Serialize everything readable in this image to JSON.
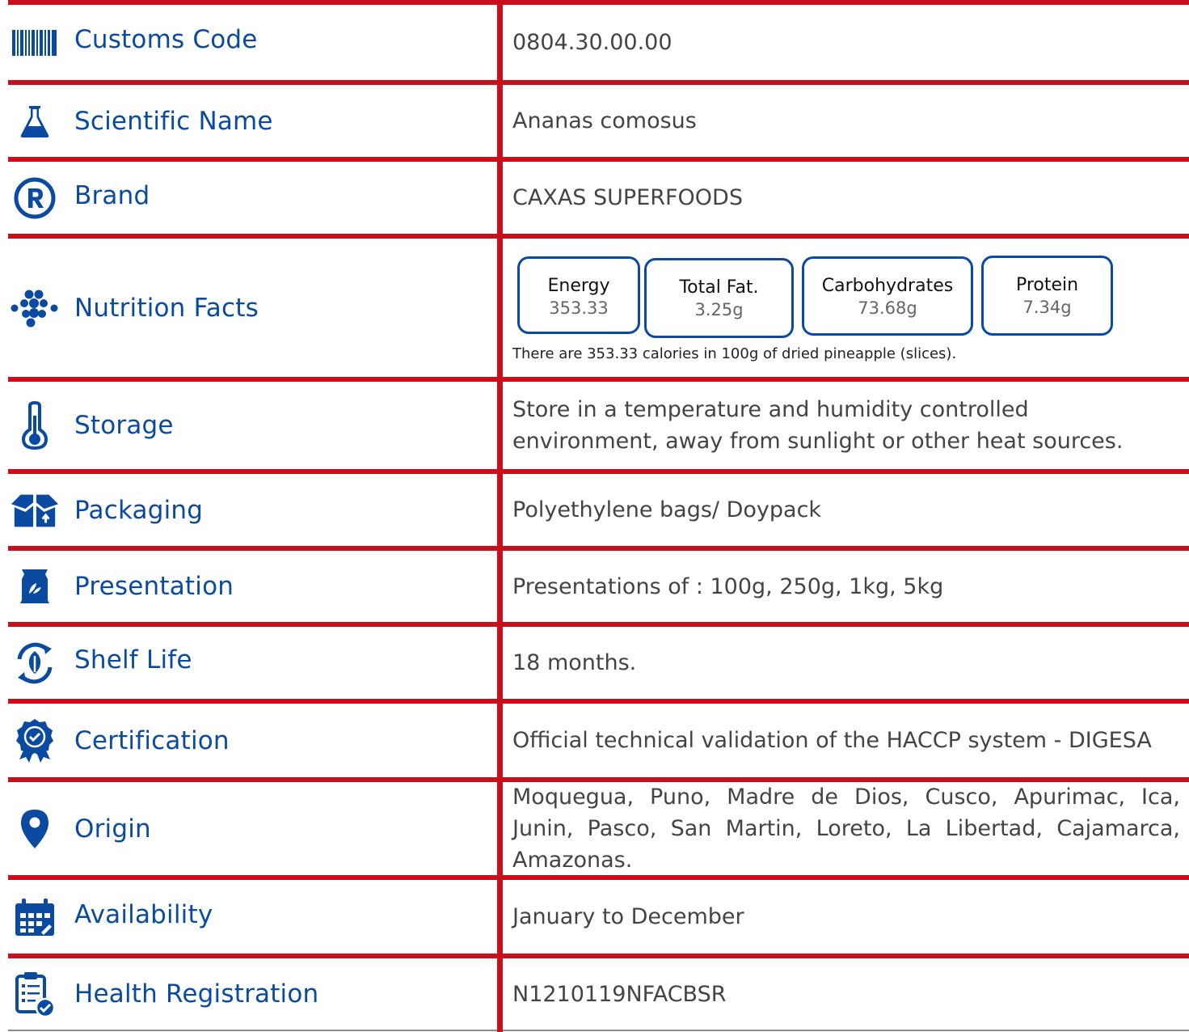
{
  "rows": {
    "customs_code": {
      "label": "Customs Code",
      "value": "0804.30.00.00"
    },
    "scientific_name": {
      "label": "Scientific Name",
      "value": "Ananas comosus"
    },
    "brand": {
      "label": "Brand",
      "value": "CAXAS SUPERFOODS"
    },
    "nutrition_facts": {
      "label": "Nutrition Facts",
      "energy": {
        "title": "Energy",
        "value": "353.33"
      },
      "total_fat": {
        "title": "Total Fat.",
        "value": "3.25g"
      },
      "carbohydrates": {
        "title": "Carbohydrates",
        "value": "73.68g"
      },
      "protein": {
        "title": "Protein",
        "value": "7.34g"
      },
      "note": "There are 353.33 calories in 100g of dried pineapple (slices)."
    },
    "storage": {
      "label": "Storage",
      "value": "Store in a temperature and humidity controlled environment, away from sunlight or other heat sources."
    },
    "packaging": {
      "label": "Packaging",
      "value": "Polyethylene bags/ Doypack"
    },
    "presentation": {
      "label": "Presentation",
      "value": "Presentations of : 100g, 250g, 1kg, 5kg"
    },
    "shelf_life": {
      "label": "Shelf Life",
      "value": "18 months."
    },
    "certification": {
      "label": "Certification",
      "value": "Official technical validation of the HACCP system - DIGESA"
    },
    "origin": {
      "label": "Origin",
      "value": "Moquegua, Puno, Madre de Dios, Cusco, Apurimac, Ica, Junin, Pasco, San Martin, Loreto, La Libertad, Cajamarca, Amazonas."
    },
    "availability": {
      "label": "Availability",
      "value": "January to December"
    },
    "health_registration": {
      "label": "Health Registration",
      "value": "N1210119NFACBSR"
    }
  },
  "icons": {
    "customs_code": "barcode-icon",
    "scientific_name": "flask-icon",
    "brand": "registered-mark-icon",
    "nutrition_facts": "molecule-icon",
    "storage": "thermometer-icon",
    "packaging": "open-box-icon",
    "presentation": "bag-icon",
    "shelf_life": "leaf-cycle-icon",
    "certification": "certification-badge-icon",
    "origin": "location-pin-icon",
    "availability": "calendar-icon",
    "health_registration": "clipboard-check-icon"
  },
  "colors": {
    "grid_lines": "#c80f1b",
    "label_text": "#0a4aa0",
    "value_text": "#444444",
    "box_border": "#0a4aa0"
  }
}
